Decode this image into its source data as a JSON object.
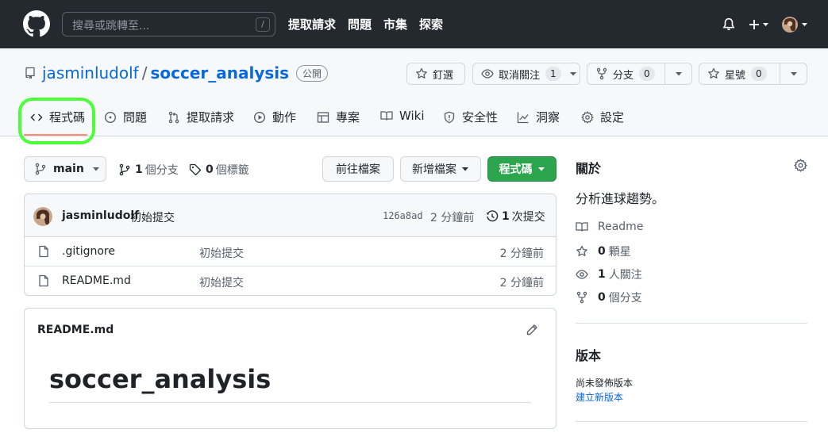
{
  "header": {
    "search_placeholder": "搜尋或跳轉至...",
    "search_shortcut": "/",
    "nav": [
      "提取請求",
      "問題",
      "市集",
      "探索"
    ]
  },
  "repo": {
    "owner": "jasminludolf",
    "separator": "/",
    "name": "soccer_analysis",
    "visibility": "公開",
    "actions": {
      "pin_label": "釘選",
      "watch_label": "取消關注",
      "watch_count": "1",
      "fork_label": "分支",
      "fork_count": "0",
      "star_label": "星號",
      "star_count": "0"
    },
    "tabs": [
      {
        "label": "程式碼",
        "icon": "code-icon"
      },
      {
        "label": "問題",
        "icon": "issue-icon"
      },
      {
        "label": "提取請求",
        "icon": "pull-request-icon"
      },
      {
        "label": "動作",
        "icon": "play-icon"
      },
      {
        "label": "專案",
        "icon": "table-icon"
      },
      {
        "label": "Wiki",
        "icon": "book-icon"
      },
      {
        "label": "安全性",
        "icon": "shield-icon"
      },
      {
        "label": "洞察",
        "icon": "graph-icon"
      },
      {
        "label": "設定",
        "icon": "gear-icon"
      }
    ]
  },
  "toolbar": {
    "branch": "main",
    "branches_count": "1",
    "branches_label": "個分支",
    "tags_count": "0",
    "tags_label": "個標籤",
    "goto_file": "前往檔案",
    "add_file": "新增檔案",
    "code_button": "程式碼"
  },
  "commit": {
    "author": "jasminludolf",
    "message": "初始提交",
    "sha": "126a8ad",
    "time": "2 分鐘前",
    "history_count": "1",
    "history_label": "次提交"
  },
  "files": [
    {
      "name": ".gitignore",
      "message": "初始提交",
      "time": "2 分鐘前"
    },
    {
      "name": "README.md",
      "message": "初始提交",
      "time": "2 分鐘前"
    }
  ],
  "readme": {
    "label": "README.md",
    "heading": "soccer_analysis"
  },
  "about": {
    "title": "關於",
    "description": "分析進球趨勢。",
    "readme_link": "Readme",
    "stars_count": "0",
    "stars_label": "顆星",
    "watchers_count": "1",
    "watchers_label": "人關注",
    "forks_count": "0",
    "forks_label": "個分支"
  },
  "releases": {
    "title": "版本",
    "none_text": "尚未發佈版本",
    "create_link": "建立新版本"
  },
  "colors": {
    "header_bg": "#24292f",
    "link_blue": "#0969da",
    "green_button": "#2da44e",
    "active_tab_underline": "#fd8c73",
    "highlight_ring": "#4cff3a"
  }
}
